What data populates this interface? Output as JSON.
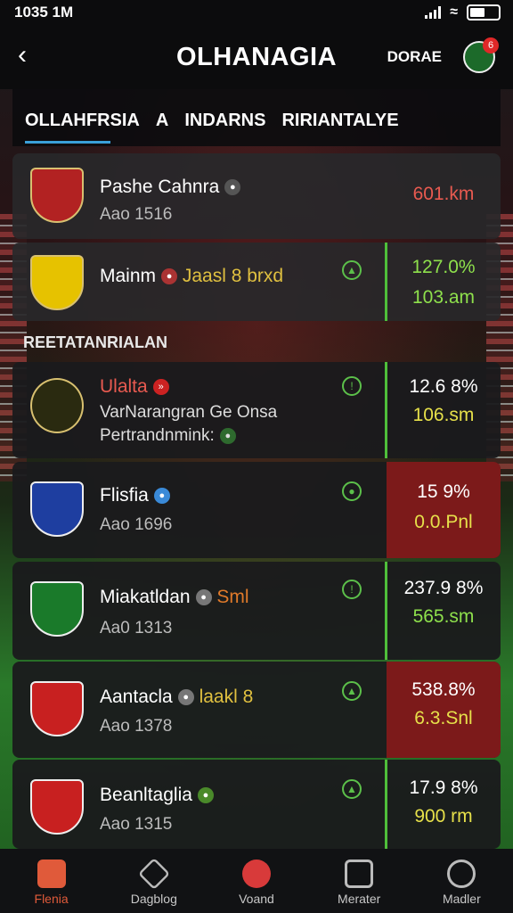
{
  "status_bar": {
    "time": "1035 1M"
  },
  "header": {
    "title": "OLHANAGIA",
    "right_link": "DORAE",
    "badge": "6"
  },
  "tabs": [
    "OLLAHFRSIA",
    "A",
    "INDARNS",
    "RIRIANTALYE"
  ],
  "section_label": "REETATANRIALAN",
  "teams": [
    {
      "name": "Pashe Cahnra",
      "sub": "Aao 1516",
      "stat_top": "601.km",
      "stat_bottom": "",
      "crest_color": "#b22222"
    },
    {
      "name": "Mainm",
      "tag": "Jaasl 8 brxd",
      "sub": "",
      "stat_top": "127.0%",
      "stat_bottom": "103.am",
      "crest_color": "#e6c200"
    },
    {
      "name": "Ulalta",
      "sub": "VarNarangran Ge Onsa",
      "sub2": "Pertrandnmink:",
      "stat_top": "12.6 8%",
      "stat_bottom": "106.sm",
      "crest_color": "#2a2a10"
    },
    {
      "name": "Flisfia",
      "sub": "Aao 1696",
      "stat_top": "15 9%",
      "stat_bottom": "0.0.Pnl",
      "crest_color": "#1e3ea0"
    },
    {
      "name": "Miakatldan",
      "tag": "Sml",
      "sub": "Aa0 1313",
      "stat_top": "237.9 8%",
      "stat_bottom": "565.sm",
      "crest_color": "#1a7a2a"
    },
    {
      "name": "Aantacla",
      "tag": "laakl 8",
      "sub": "Aao 1378",
      "stat_top": "538.8%",
      "stat_bottom": "6.3.Snl",
      "crest_color": "#c82020"
    },
    {
      "name": "Beanltaglia",
      "sub": "Aao 1315",
      "stat_top": "17.9 8%",
      "stat_bottom": "900 rm",
      "crest_color": "#c82020"
    }
  ],
  "bottom_nav": [
    "Flenia",
    "Dagblog",
    "Voand",
    "Merater",
    "Madler"
  ],
  "colors": {
    "accent_green": "#4fbf3a",
    "accent_red": "#7c1a1a",
    "tab_underline": "#3aa0d8"
  }
}
